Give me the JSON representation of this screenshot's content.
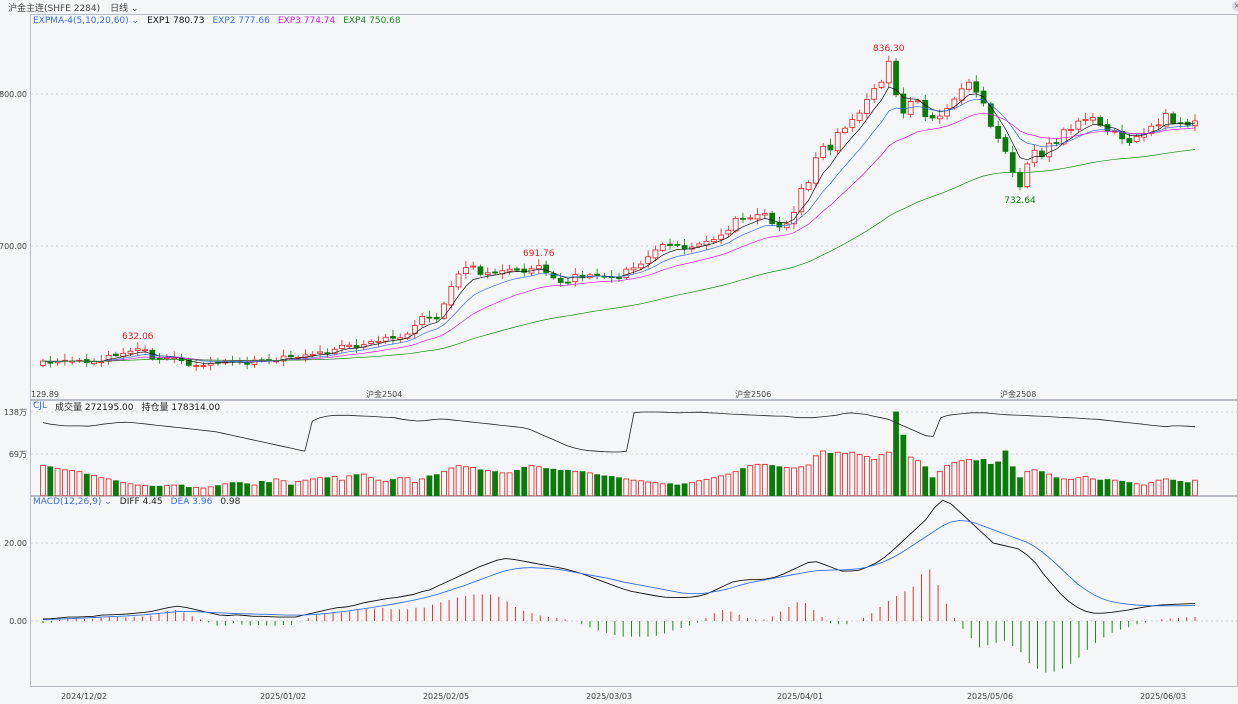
{
  "window": {
    "instrument": "沪金主连(SHFE 2284)",
    "period": "日线",
    "period_chevron": "chevron-down-icon"
  },
  "main_panel": {
    "indicator": "EXPMA-4(5,10,20,60)",
    "exp1": {
      "label": "EXP1",
      "value": "780.73",
      "color": "#111111"
    },
    "exp2": {
      "label": "EXP2",
      "value": "777.66",
      "color": "#3a6fd8"
    },
    "exp3": {
      "label": "EXP3",
      "value": "774.74",
      "color": "#d11fd1"
    },
    "exp4": {
      "label": "EXP4",
      "value": "750.68",
      "color": "#1d8a1d"
    },
    "contract_marks": [
      "沪金2504",
      "沪金2506",
      "沪金2508"
    ],
    "price_axis_labels": [
      "800.00",
      "700.00"
    ],
    "bottom_label": "129.89"
  },
  "volume_panel": {
    "indicator": "CJL",
    "vol_label": "成交量",
    "vol_value": "272195.00",
    "oi_label": "持仓量",
    "oi_value": "178314.00",
    "axis_labels": [
      "138万",
      "69万"
    ]
  },
  "macd_panel": {
    "indicator": "MACD(12,26,9)",
    "diff_label": "DIFF",
    "diff_value": "4.45",
    "dea_label": "DEA",
    "dea_value": "3.96",
    "macd_value": "0.98",
    "axis_labels": [
      "20.00",
      "0.00"
    ]
  },
  "date_axis": [
    "2024/12/02",
    "2025/01/02",
    "2025/02/05",
    "2025/03/03",
    "2025/04/01",
    "2025/05/06",
    "2025/06/03"
  ],
  "colors": {
    "up": "#e02020",
    "down": "#0b7a0b",
    "background": "#f5f6f8",
    "grid": "#cfd3da"
  },
  "chart_data": {
    "type": "candlestick",
    "title": "沪金主连(SHFE 2284) 日线",
    "annotations": [
      {
        "label": "632.06",
        "type": "high"
      },
      {
        "label": "691.76",
        "type": "high"
      },
      {
        "label": "836.30",
        "type": "high"
      },
      {
        "label": "732.64",
        "type": "low"
      }
    ],
    "price_range": [
      607,
      850
    ],
    "price_close": [
      624.3,
      622.9,
      624.0,
      624.8,
      624.3,
      624.8,
      623.4,
      624.0,
      623.9,
      628.1,
      627.9,
      629.4,
      630.8,
      632.4,
      631.7,
      625.8,
      625.5,
      626.7,
      626.3,
      624.6,
      621.5,
      621.4,
      621.3,
      622.8,
      623.5,
      624.2,
      624.1,
      623.6,
      622.3,
      624.9,
      624.5,
      624.9,
      624.4,
      627.6,
      627.1,
      626.7,
      628.4,
      628.7,
      630.3,
      629.2,
      632.1,
      634.6,
      634.8,
      633.3,
      635.1,
      637.1,
      637.3,
      640.0,
      639.3,
      639.6,
      642.1,
      647.6,
      653.7,
      653.1,
      652.0,
      661.9,
      673.3,
      681.6,
      685.8,
      686.8,
      681.3,
      682.4,
      682.4,
      683.7,
      684.8,
      684.1,
      682.7,
      685.0,
      687.0,
      682.6,
      679.0,
      676.0,
      675.8,
      681.2,
      679.1,
      681.0,
      680.9,
      680.1,
      679.2,
      678.6,
      684.8,
      685.6,
      688.1,
      692.9,
      697.4,
      701.0,
      700.3,
      700.8,
      698.0,
      699.3,
      701.4,
      703.1,
      704.2,
      707.2,
      710.4,
      718.2,
      717.9,
      718.5,
      720.6,
      721.3,
      714.7,
      712.5,
      714.6,
      722.0,
      737.8,
      741.6,
      758.0,
      765.6,
      763.2,
      774.6,
      777.5,
      783.2,
      787.5,
      796.3,
      803.6,
      807.8,
      821.6,
      799.5,
      787.4,
      795.1,
      795.6,
      785.1,
      784.2,
      785.5,
      790.4,
      796.7,
      803.4,
      807.8,
      801.2,
      794.0,
      778.7,
      770.8,
      762.2,
      748.7,
      738.9,
      754.0,
      763.0,
      758.7,
      767.6,
      767.9,
      776.4,
      776.6,
      782.2,
      783.3,
      784.6,
      779.4,
      775.9,
      775.6,
      770.5,
      768.0,
      772.1,
      774.0,
      778.8,
      779.7,
      787.2,
      780.9,
      780.7,
      779.6,
      782.3
    ],
    "volume_range_wan": [
      0,
      138
    ],
    "volume_wan": [
      50,
      48,
      45,
      43,
      42,
      40,
      36,
      34,
      30,
      28,
      25,
      22,
      20,
      18,
      17,
      16,
      16,
      17,
      18,
      18,
      14,
      14,
      13,
      15,
      17,
      20,
      22,
      22,
      20,
      18,
      24,
      22,
      28,
      25,
      18,
      24,
      26,
      28,
      30,
      30,
      32,
      26,
      33,
      35,
      36,
      30,
      26,
      24,
      27,
      30,
      30,
      22,
      28,
      33,
      35,
      40,
      46,
      50,
      48,
      47,
      43,
      42,
      40,
      38,
      38,
      42,
      47,
      50,
      48,
      45,
      44,
      42,
      42,
      40,
      40,
      38,
      35,
      33,
      32,
      30,
      28,
      26,
      25,
      23,
      22,
      20,
      20,
      18,
      20,
      22,
      25,
      27,
      30,
      33,
      36,
      40,
      45,
      50,
      52,
      52,
      50,
      48,
      47,
      46,
      48,
      51,
      66,
      74,
      70,
      72,
      70,
      72,
      68,
      65,
      60,
      68,
      72,
      138,
      100,
      64,
      58,
      48,
      30,
      40,
      50,
      55,
      58,
      60,
      58,
      60,
      52,
      56,
      74,
      48,
      30,
      40,
      43,
      40,
      36,
      30,
      28,
      27,
      30,
      32,
      28,
      26,
      27,
      26,
      24,
      22,
      20,
      18,
      22,
      26,
      28,
      26,
      24,
      22,
      26
    ],
    "open_interest_wan": [
      1020,
      1010,
      1005,
      1000,
      1000,
      1000,
      998,
      1003,
      1010,
      1015,
      1020,
      1022,
      1020,
      1015,
      1010,
      1005,
      1000,
      995,
      990,
      985,
      980,
      975,
      970,
      965,
      955,
      945,
      935,
      925,
      915,
      905,
      895,
      885,
      875,
      865,
      855,
      845,
      1030,
      1050,
      1060,
      1065,
      1065,
      1065,
      1062,
      1060,
      1058,
      1055,
      1052,
      1050,
      1040,
      1035,
      1030,
      1032,
      1038,
      1042,
      1040,
      1035,
      1030,
      1025,
      1020,
      1015,
      1010,
      1005,
      1000,
      995,
      990,
      980,
      960,
      940,
      920,
      900,
      880,
      865,
      855,
      848,
      845,
      842,
      840,
      840,
      845,
      1080,
      1085,
      1085,
      1085,
      1084,
      1082,
      1080,
      1082,
      1083,
      1084,
      1080,
      1078,
      1075,
      1072,
      1070,
      1068,
      1066,
      1064,
      1062,
      1060,
      1060,
      1055,
      1050,
      1050,
      1050,
      1055,
      1060,
      1065,
      1075,
      1080,
      1075,
      1070,
      1060,
      1050,
      1040,
      1020,
      1000,
      980,
      960,
      940,
      935,
      1050,
      1065,
      1070,
      1075,
      1080,
      1080,
      1080,
      1075,
      1070,
      1068,
      1066,
      1064,
      1062,
      1060,
      1058,
      1055,
      1052,
      1050,
      1048,
      1045,
      1042,
      1040,
      1035,
      1030,
      1025,
      1020,
      1015,
      1010,
      1005,
      1000,
      995,
      1000,
      1000,
      998,
      995
    ],
    "macd_range": [
      -20,
      30
    ],
    "diff": [
      0.5,
      0.6,
      0.8,
      1.0,
      1.0,
      1.1,
      1.2,
      1.5,
      1.6,
      1.7,
      1.8,
      2.0,
      2.2,
      2.5,
      3.0,
      3.5,
      3.8,
      3.5,
      3.0,
      2.5,
      2.0,
      1.5,
      1.4,
      1.6,
      1.4,
      1.2,
      1.2,
      1.1,
      1.0,
      1.0,
      1.0,
      1.5,
      2.0,
      2.5,
      3.0,
      3.4,
      3.6,
      4.0,
      4.6,
      5.0,
      5.4,
      5.8,
      6.0,
      6.4,
      6.8,
      7.5,
      8.0,
      9.0,
      10.0,
      11.0,
      12.0,
      13.0,
      14.0,
      14.8,
      15.6,
      16.0,
      15.8,
      15.4,
      15.0,
      14.6,
      14.2,
      13.8,
      13.4,
      12.8,
      12.2,
      11.4,
      10.6,
      9.8,
      9.0,
      8.2,
      7.6,
      7.2,
      6.8,
      6.4,
      6.1,
      6.0,
      6.0,
      6.1,
      6.4,
      7.0,
      8.0,
      9.0,
      10.0,
      10.4,
      10.6,
      10.6,
      10.8,
      11.2,
      12.0,
      13.0,
      14.0,
      15.0,
      15.2,
      14.4,
      13.6,
      12.8,
      12.8,
      13.0,
      13.8,
      14.8,
      16.2,
      18.0,
      20.0,
      22.0,
      24.0,
      26.0,
      29.0,
      31.0,
      30.0,
      28.0,
      26.0,
      24.0,
      22.0,
      20.0,
      19.5,
      19.0,
      18.5,
      17.0,
      15.0,
      12.0,
      9.5,
      7.0,
      5.0,
      3.5,
      2.5,
      2.0,
      2.0,
      2.2,
      2.5,
      2.8,
      3.2,
      3.6,
      3.9,
      4.1,
      4.2,
      4.3,
      4.4,
      4.45
    ],
    "dea": [
      0.3,
      0.4,
      0.5,
      0.6,
      0.7,
      0.8,
      0.9,
      1.0,
      1.1,
      1.2,
      1.3,
      1.45,
      1.6,
      1.8,
      2.0,
      2.2,
      2.4,
      2.4,
      2.4,
      2.3,
      2.2,
      2.1,
      2.0,
      1.9,
      1.85,
      1.8,
      1.75,
      1.7,
      1.6,
      1.5,
      1.5,
      1.55,
      1.65,
      1.8,
      2.0,
      2.25,
      2.5,
      2.8,
      3.1,
      3.4,
      3.8,
      4.1,
      4.5,
      4.9,
      5.3,
      5.8,
      6.3,
      6.9,
      7.6,
      8.3,
      9.0,
      9.8,
      10.6,
      11.4,
      12.2,
      12.9,
      13.3,
      13.6,
      13.7,
      13.6,
      13.5,
      13.3,
      13.0,
      12.6,
      12.2,
      11.8,
      11.4,
      11.0,
      10.5,
      10.0,
      9.6,
      9.2,
      8.8,
      8.4,
      8.0,
      7.6,
      7.2,
      7.0,
      7.0,
      7.2,
      7.6,
      8.0,
      8.6,
      9.2,
      9.8,
      10.2,
      10.6,
      11.0,
      11.4,
      11.8,
      12.2,
      12.6,
      12.9,
      13.0,
      13.1,
      13.1,
      13.2,
      13.4,
      13.8,
      14.4,
      15.2,
      16.2,
      17.4,
      18.8,
      20.2,
      21.6,
      23.0,
      24.4,
      25.4,
      25.8,
      25.6,
      25.0,
      24.2,
      23.4,
      22.6,
      21.8,
      21.0,
      20.2,
      19.0,
      17.4,
      15.6,
      13.6,
      11.5,
      9.6,
      8.0,
      6.7,
      5.7,
      5.0,
      4.6,
      4.3,
      4.1,
      4.0,
      3.9,
      3.9,
      3.9,
      3.9,
      3.92,
      3.96
    ],
    "macd_bar_values": [
      -0.5,
      -0.4,
      0.3,
      0.5,
      0.6,
      0.5,
      0.6,
      1.0,
      1.0,
      1.0,
      0.9,
      1.1,
      1.2,
      1.4,
      2.0,
      2.6,
      2.8,
      2.2,
      1.2,
      0.4,
      -0.4,
      -1.2,
      -1.2,
      -0.6,
      -0.9,
      -1.2,
      -1.1,
      -1.2,
      -1.2,
      -1.0,
      -1.0,
      -0.1,
      0.7,
      1.4,
      2.0,
      2.3,
      2.2,
      2.4,
      3.0,
      3.2,
      3.2,
      3.4,
      3.0,
      3.0,
      3.0,
      3.4,
      3.4,
      4.2,
      4.8,
      5.4,
      6.0,
      6.4,
      6.8,
      6.8,
      6.8,
      6.2,
      5.0,
      3.6,
      2.6,
      2.0,
      1.4,
      1.0,
      0.8,
      0.4,
      0.0,
      -0.8,
      -1.6,
      -2.4,
      -3.0,
      -3.6,
      -4.0,
      -4.0,
      -4.0,
      -4.0,
      -3.8,
      -3.2,
      -2.4,
      -1.8,
      -1.2,
      -0.4,
      0.8,
      2.0,
      2.8,
      2.4,
      1.6,
      0.8,
      0.4,
      0.4,
      1.2,
      2.4,
      3.6,
      4.8,
      4.6,
      2.8,
      1.0,
      -0.6,
      -0.8,
      -0.8,
      0.0,
      0.8,
      2.0,
      3.6,
      5.2,
      6.4,
      7.6,
      8.8,
      12.0,
      13.2,
      9.2,
      4.4,
      0.8,
      -2.0,
      -4.4,
      -6.8,
      -6.2,
      -5.6,
      -5.0,
      -6.4,
      -8.0,
      -10.8,
      -12.2,
      -13.2,
      -13.0,
      -12.2,
      -11.0,
      -9.4,
      -7.4,
      -5.6,
      -4.2,
      -3.0,
      -2.2,
      -1.6,
      -0.8,
      -0.4,
      0.0,
      0.4,
      0.6,
      0.8,
      0.96,
      0.98
    ]
  }
}
